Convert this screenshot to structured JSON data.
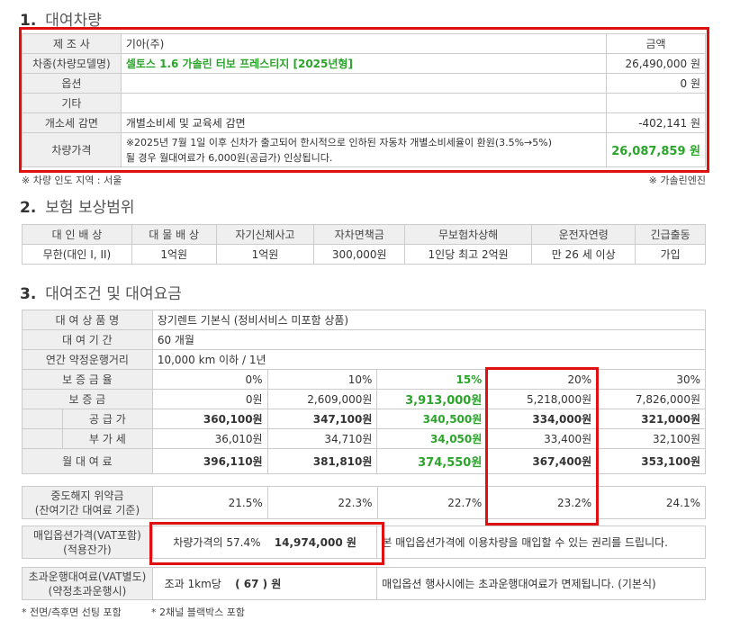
{
  "s1": {
    "num": "1.",
    "title": "대여차량",
    "rows": {
      "maker_label": "제 조 사",
      "maker": "기아(주)",
      "amount_label": "금액",
      "model_label": "차종(차량모델명)",
      "model": "셀토스  1.6 가솔린 터보 프레스티지 [2025년형]",
      "model_price": "26,490,000 원",
      "option_label": "옵션",
      "option_price": "0 원",
      "etc_label": "기타",
      "tax_label": "개소세 감면",
      "tax_desc": "개별소비세 및 교육세 감면",
      "tax_price": "-402,141 원",
      "price_label": "차량가격",
      "price_note1": "※2025년 7월 1일 이후 신차가 출고되어 한시적으로 인하된 자동차 개별소비세율이 환원(3.5%→5%)",
      "price_note2": "될 경우 월대여료가 6,000원(공급가) 인상됩니다.",
      "price_total": "26,087,859 원"
    },
    "note_left": "※ 차량 인도 지역 : 서울",
    "note_right": "※ 가솔린엔진"
  },
  "s2": {
    "num": "2.",
    "title": "보험 보상범위",
    "headers": [
      "대 인 배 상",
      "대 물 배 상",
      "자기신체사고",
      "자차면책금",
      "무보험차상해",
      "운전자연령",
      "긴급출동"
    ],
    "values": [
      "무한(대인 I, II)",
      "1억원",
      "1억원",
      "300,000원",
      "1인당 최고 2억원",
      "만 26 세 이상",
      "가입"
    ]
  },
  "s3": {
    "num": "3.",
    "title": "대여조건 및 대여요금",
    "product_label": "대 여 상 품 명",
    "product": "장기렌트 기본식 (정비서비스 미포함 상품)",
    "period_label": "대 여 기 간",
    "period": "60 개월",
    "mileage_label": "연간 약정운행거리",
    "mileage": "10,000 km 이하 / 1년",
    "rate_label": "보 증 금 율",
    "rates": [
      "0%",
      "10%",
      "15%",
      "20%",
      "30%"
    ],
    "deposit_label": "보 증 금",
    "deposits": [
      "0원",
      "2,609,000원",
      "3,913,000원",
      "5,218,000원",
      "7,826,000원"
    ],
    "supply_label": "공 급 가",
    "supplies": [
      "360,100원",
      "347,100원",
      "340,500원",
      "334,000원",
      "321,000원"
    ],
    "vat_label": "부 가 세",
    "vats": [
      "36,010원",
      "34,710원",
      "34,050원",
      "33,400원",
      "32,100원"
    ],
    "monthly_label": "월 대 여 료",
    "monthlies": [
      "396,110원",
      "381,810원",
      "374,550원",
      "367,400원",
      "353,100원"
    ],
    "penalty_label1": "중도해지 위약금",
    "penalty_label2": "(잔여기간 대여료 기준)",
    "penalties": [
      "21.5%",
      "22.3%",
      "22.7%",
      "23.2%",
      "24.1%"
    ],
    "buyout_label1": "매입옵션가격(VAT포함)",
    "buyout_label2": "(적용잔가)",
    "buyout_ratio": "차량가격의 57.4%",
    "buyout_price": "14,974,000 원",
    "buyout_desc": "본 매입옵션가격에 이용차량을 매입할 수 있는 권리를 드립니다.",
    "excess_label1": "초과운행대여료(VAT별도)",
    "excess_label2": "(약정초과운행시)",
    "excess_prefix": "조과 1km당",
    "excess_value": "( 67 ) 원",
    "excess_desc": "매입옵션 행사시에는 초과운행대여료가 면제됩니다. (기본식)",
    "footnote1": "* 전면/측후면 선팅 포함",
    "footnote2": "* 2채널 블랙박스 포함"
  },
  "colors": {
    "highlight": "#2aa52a",
    "redbox": "#e01010"
  }
}
